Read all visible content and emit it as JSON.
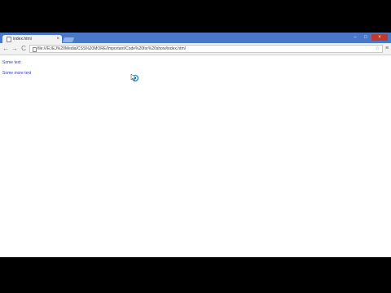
{
  "browser": {
    "tab": {
      "title": "index.html",
      "close_label": "×",
      "favicon": "page-icon"
    },
    "window_controls": {
      "minimize": "–",
      "maximize": "□",
      "close": "×"
    },
    "toolbar": {
      "back_icon": "←",
      "forward_icon": "→",
      "reload_icon": "C",
      "url": "file:///E:/EJ%20Media/CSS%20MORE/Important/Code%20for%20show/index.html",
      "bookmark_icon": "☆",
      "menu_icon": "≡"
    }
  },
  "content": {
    "links": [
      "Some text",
      "Some more text"
    ]
  },
  "colors": {
    "titlebar": "#4a78c8",
    "link": "#3333cc",
    "letterbox": "#000000"
  }
}
